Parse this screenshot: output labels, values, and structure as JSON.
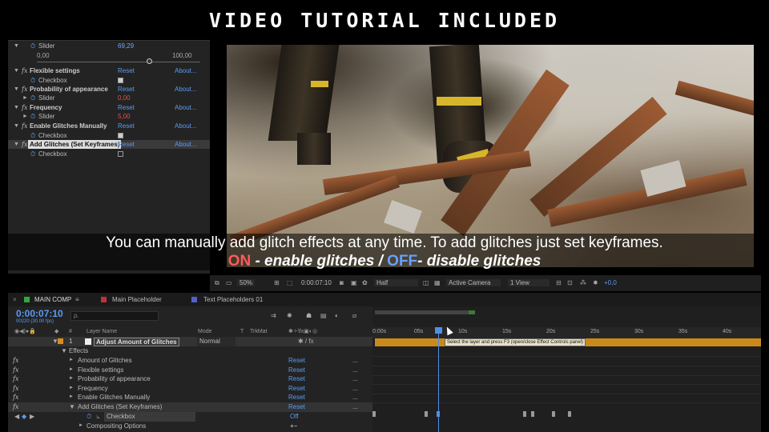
{
  "banner": {
    "title": "VIDEO TUTORIAL INCLUDED"
  },
  "effect_controls": {
    "slider_label": "Slider",
    "slider_value": "69,29",
    "range_min": "0,00",
    "range_max": "100,00",
    "slider_position": 0.6929,
    "groups": [
      {
        "name": "Flexible settings",
        "reset": "Reset",
        "about": "About...",
        "child": "Checkbox",
        "child_value": "checked"
      },
      {
        "name": "Probability of appearance",
        "reset": "Reset",
        "about": "About...",
        "child": "Slider",
        "child_value": "0,00"
      },
      {
        "name": "Frequency",
        "reset": "Reset",
        "about": "About...",
        "child": "Slider",
        "child_value": "5,00"
      },
      {
        "name": "Enable Glitches Manually",
        "reset": "Reset",
        "about": "About...",
        "child": "Checkbox",
        "child_value": "checked"
      },
      {
        "name": "Add Glitches (Set Keyframes)",
        "reset": "Reset",
        "about": "About...",
        "child": "Checkbox",
        "child_value": "unchecked"
      }
    ]
  },
  "caption": {
    "line1": "You can manually add glitch effects at any time. To add glitches just set keyframes.",
    "on": "ON",
    "on_text": " - enable glitches / ",
    "off": "OFF",
    "off_text": "- disable glitches"
  },
  "viewer_toolbar": {
    "zoom": "50%",
    "timecode": "0:00:07:10",
    "resolution": "Half",
    "camera": "Active Camera",
    "views": "1 View",
    "exposure": "+0,0"
  },
  "timeline": {
    "tabs": [
      {
        "label": "MAIN COMP",
        "color": "#2faa3a"
      },
      {
        "label": "Main Placeholder",
        "color": "#c0303a"
      },
      {
        "label": "Text Placeholders 01",
        "color": "#5560c8"
      }
    ],
    "menu_glyph": "≡",
    "timecode": "0:00:07:10",
    "timecode_sub": "00220 (30.00 fps)",
    "search_placeholder": "ρ.",
    "columns": {
      "hash": "#",
      "layer_name": "Layer Name",
      "mode": "Mode",
      "t": "T",
      "trkmat": "TrkMat"
    },
    "layer": {
      "number": "1",
      "name": "Adjust Amount of Glitches",
      "mode": "Normal"
    },
    "effects_label": "Effects",
    "effects": [
      {
        "name": "Amount of Glitches",
        "reset": "Reset",
        "dots": "..."
      },
      {
        "name": "Flexible settings",
        "reset": "Reset",
        "dots": "..."
      },
      {
        "name": "Probability of appearance",
        "reset": "Reset",
        "dots": "..."
      },
      {
        "name": "Frequency",
        "reset": "Reset",
        "dots": "..."
      },
      {
        "name": "Enable Glitches Manually",
        "reset": "Reset",
        "dots": "..."
      },
      {
        "name": "Add Glitches (Set Keyframes)",
        "reset": "Reset",
        "dots": "..."
      }
    ],
    "checkbox_label": "Checkbox",
    "checkbox_value": "Off",
    "compositing": "Compositing Options",
    "compositing_controls": "+−",
    "ruler_ticks": [
      "0:00s",
      "05s",
      "10s",
      "15s",
      "20s",
      "25s",
      "30s",
      "35s",
      "40s"
    ],
    "tooltip": "Select the layer and press F3 (open/close Effect Controls panel)"
  }
}
